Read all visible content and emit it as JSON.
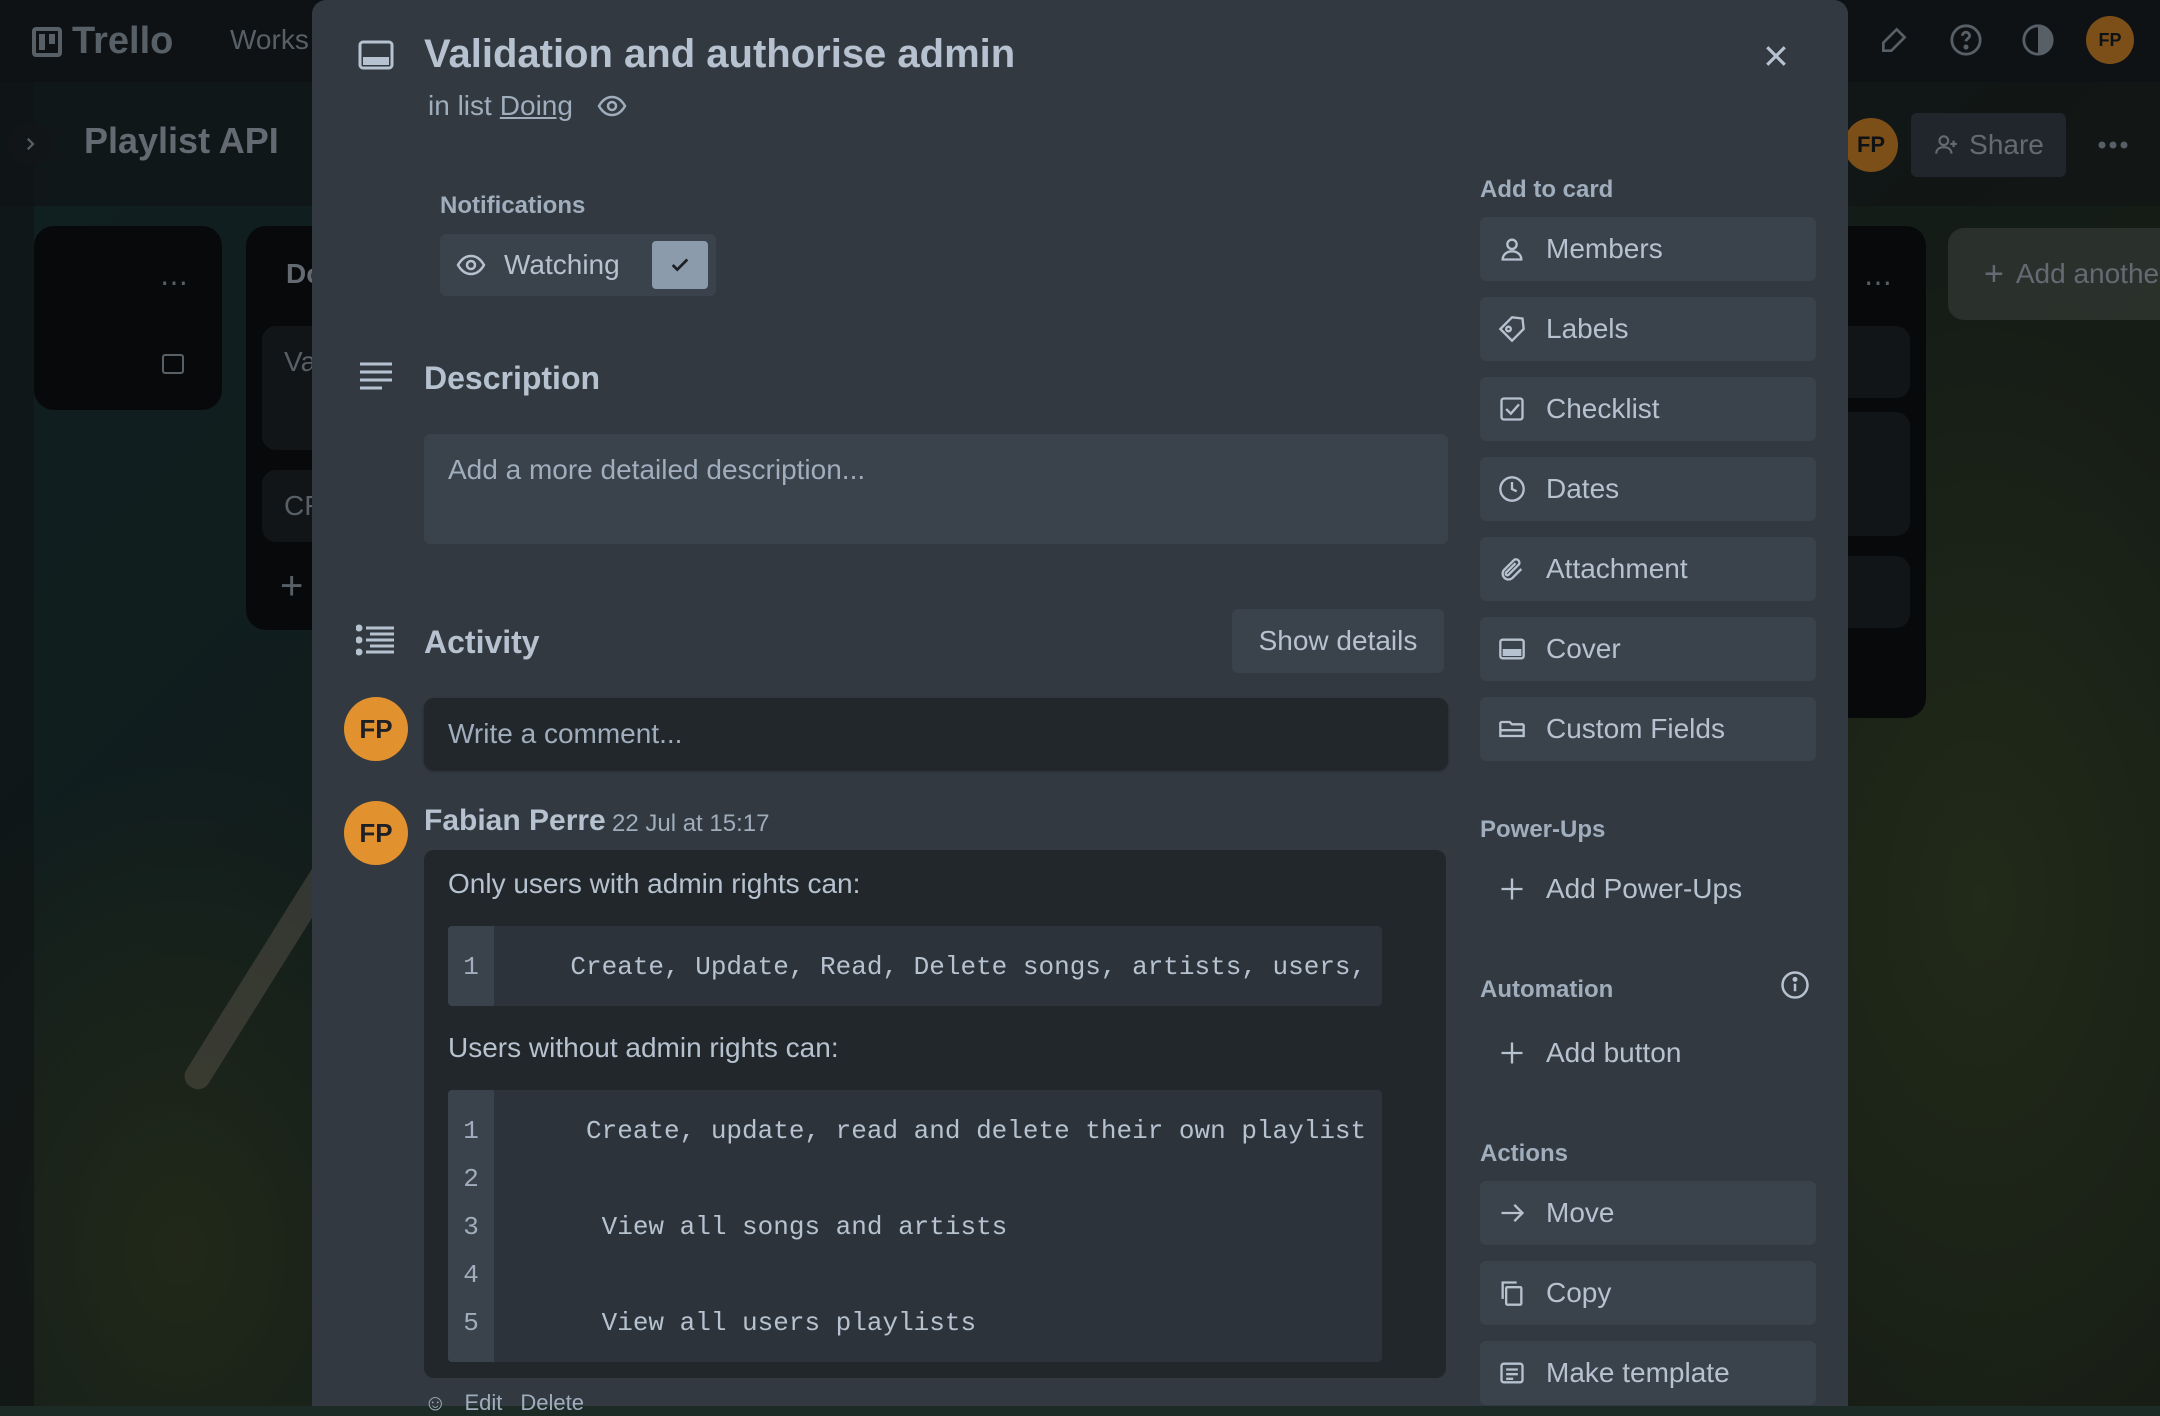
{
  "app": {
    "name": "Trello",
    "workspace_label": "Works"
  },
  "board": {
    "title": "Playlist API",
    "share_label": "Share",
    "user_initials": "FP"
  },
  "lists": {
    "doing_header": "Do",
    "card1_preview": "Va",
    "card2_preview": "CF",
    "add_another": "Add anothe"
  },
  "card": {
    "title": "Validation and authorise admin",
    "in_list_prefix": "in list",
    "list_name": "Doing",
    "notifications_heading": "Notifications",
    "watching_label": "Watching",
    "description_heading": "Description",
    "description_placeholder": "Add a more detailed description...",
    "activity_heading": "Activity",
    "show_details_label": "Show details",
    "comment_placeholder": "Write a comment...",
    "comment": {
      "author": "Fabian Perre",
      "initials": "FP",
      "timestamp": "22 Jul at 15:17",
      "admin_intro": "Only users with admin rights can:",
      "admin_code": [
        {
          "n": "1",
          "text": "    Create, Update, Read, Delete songs, artists, users, pl"
        }
      ],
      "user_intro": "Users without admin rights can:",
      "user_code": [
        {
          "n": "1",
          "text": "     Create, update, read and delete their own playlist"
        },
        {
          "n": "2",
          "text": ""
        },
        {
          "n": "3",
          "text": "      View all songs and artists"
        },
        {
          "n": "4",
          "text": ""
        },
        {
          "n": "5",
          "text": "      View all users playlists"
        }
      ],
      "edit_label": "Edit",
      "delete_label": "Delete"
    }
  },
  "sidebar": {
    "add_to_card_heading": "Add to card",
    "add_to_card": [
      {
        "label": "Members",
        "icon": "person-icon"
      },
      {
        "label": "Labels",
        "icon": "tag-icon"
      },
      {
        "label": "Checklist",
        "icon": "checklist-icon"
      },
      {
        "label": "Dates",
        "icon": "clock-icon"
      },
      {
        "label": "Attachment",
        "icon": "paperclip-icon"
      },
      {
        "label": "Cover",
        "icon": "cover-icon"
      },
      {
        "label": "Custom Fields",
        "icon": "custom-fields-icon"
      }
    ],
    "powerups_heading": "Power-Ups",
    "add_powerups_label": "Add Power-Ups",
    "automation_heading": "Automation",
    "add_button_label": "Add button",
    "actions_heading": "Actions",
    "actions": [
      {
        "label": "Move",
        "icon": "arrow-right-icon"
      },
      {
        "label": "Copy",
        "icon": "copy-icon"
      },
      {
        "label": "Make template",
        "icon": "template-icon"
      }
    ]
  },
  "colors": {
    "accent_avatar": "#e2912f",
    "modal_bg": "#323940",
    "button_bg": "#3a424b"
  }
}
